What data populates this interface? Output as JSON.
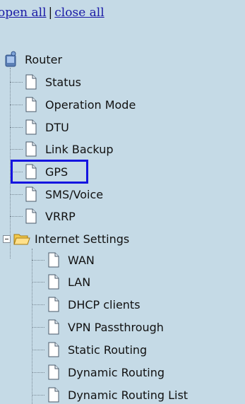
{
  "header": {
    "open_all": "open all",
    "separator": "|",
    "close_all": "close all"
  },
  "tree": {
    "root_label": "Router",
    "items": [
      {
        "label": "Status"
      },
      {
        "label": "Operation Mode"
      },
      {
        "label": "DTU"
      },
      {
        "label": "Link Backup"
      },
      {
        "label": "GPS",
        "selected": true
      },
      {
        "label": "SMS/Voice"
      },
      {
        "label": "VRRP"
      }
    ],
    "folder": {
      "label": "Internet Settings",
      "expanded": true,
      "children": [
        {
          "label": "WAN"
        },
        {
          "label": "LAN"
        },
        {
          "label": "DHCP clients"
        },
        {
          "label": "VPN Passthrough"
        },
        {
          "label": "Static Routing"
        },
        {
          "label": "Dynamic Routing"
        },
        {
          "label": "Dynamic Routing List"
        }
      ]
    }
  },
  "colors": {
    "background": "#c5dae6",
    "link": "#1a1aa6",
    "selection_outline": "#1414e0",
    "folder": "#f2c94c"
  }
}
